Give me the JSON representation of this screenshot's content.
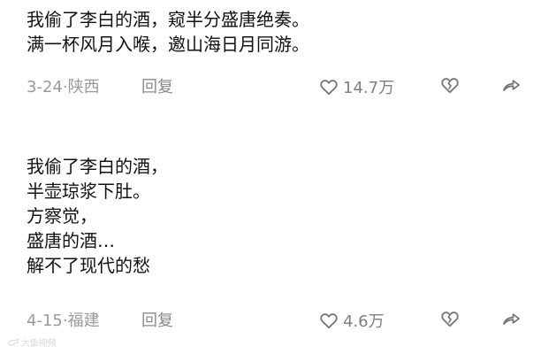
{
  "comments": [
    {
      "text": "我偷了李白的酒，窥半分盛唐绝奏。\n满一杯风月入喉，邀山海日月同游。",
      "date_location": "3-24·陕西",
      "reply_label": "回复",
      "like_count": "14.7万"
    },
    {
      "text": "我偷了李白的酒，\n半壶琼浆下肚。\n方察觉，\n盛唐的酒…\n解不了现代的愁",
      "date_location": "4-15·福建",
      "reply_label": "回复",
      "like_count": "4.6万"
    }
  ],
  "icons": {
    "like": "heart-outline-icon",
    "dislike": "broken-heart-icon",
    "share": "share-arrow-icon"
  },
  "watermark": {
    "text": "大鱼视频"
  },
  "colors": {
    "text": "#111111",
    "meta": "#9a9a9a",
    "icon": "#777777"
  }
}
